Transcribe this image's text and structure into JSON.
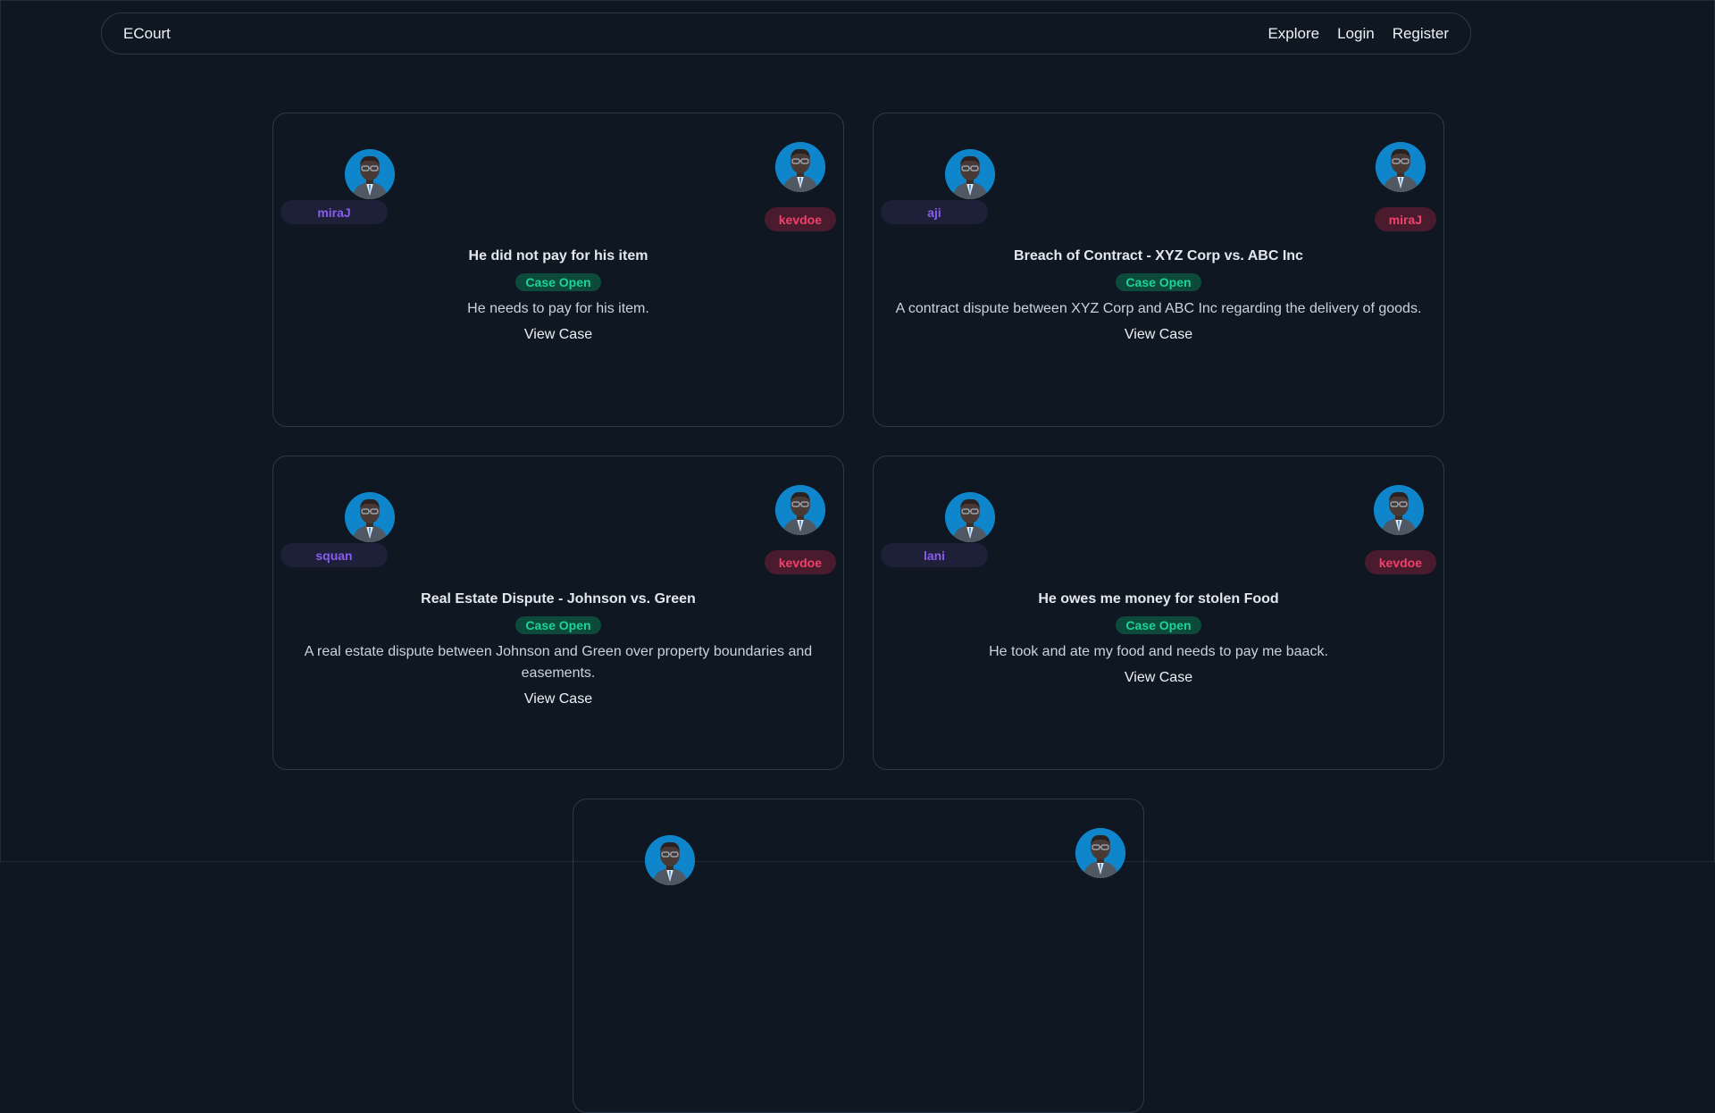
{
  "nav": {
    "brand": "ECourt",
    "links": [
      "Explore",
      "Login",
      "Register"
    ]
  },
  "cases": [
    {
      "plaintiff": "miraJ",
      "defendant": "kevdoe",
      "title": "He did not pay for his item",
      "status": "Case Open",
      "description": "He needs to pay for his item.",
      "action": "View Case"
    },
    {
      "plaintiff": "aji",
      "defendant": "miraJ",
      "title": "Breach of Contract - XYZ Corp vs. ABC Inc",
      "status": "Case Open",
      "description": "A contract dispute between XYZ Corp and ABC Inc regarding the delivery of goods.",
      "action": "View Case"
    },
    {
      "plaintiff": "squan",
      "defendant": "kevdoe",
      "title": "Real Estate Dispute - Johnson vs. Green",
      "status": "Case Open",
      "description": "A real estate dispute between Johnson and Green over property boundaries and easements.",
      "action": "View Case"
    },
    {
      "plaintiff": "lani",
      "defendant": "kevdoe",
      "title": "He owes me money for stolen Food",
      "status": "Case Open",
      "description": "He took and ate my food and needs to pay me baack.",
      "action": "View Case"
    }
  ],
  "colors": {
    "background": "#0e1722",
    "plaintiff_badge": "#8a5cf0",
    "defendant_badge": "#f0426a",
    "status_badge": "#1ed39a",
    "avatar_bg": "#0f86cc"
  },
  "icons": {
    "avatar": "user-avatar-icon"
  }
}
